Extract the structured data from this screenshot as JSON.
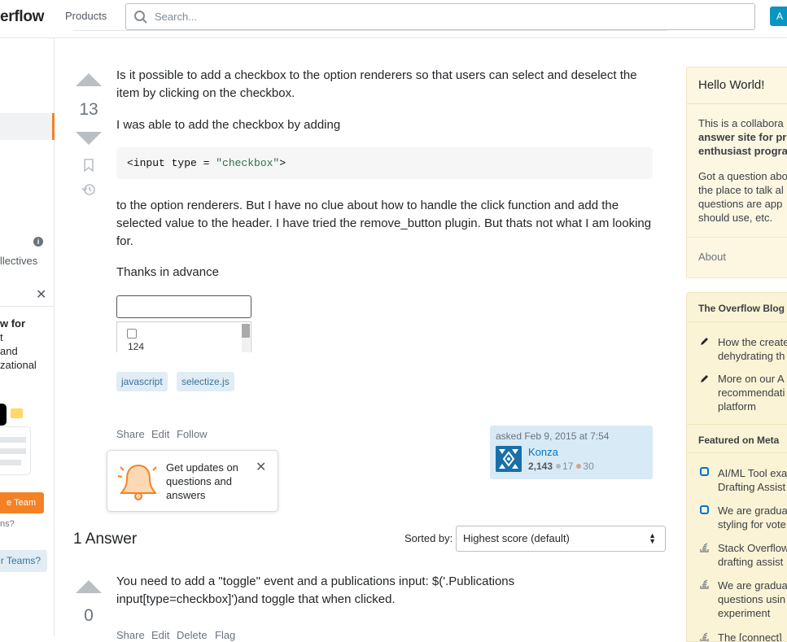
{
  "topbar": {
    "logo": "erflow",
    "products": "Products",
    "search_placeholder": "Search...",
    "avatar_letter": "A"
  },
  "left_sidebar": {
    "collectives": "llectives",
    "promo_lines": [
      "w for",
      "t",
      "and",
      "zational"
    ],
    "team_button": "e Team",
    "teams_question": "ns?",
    "teams_button": "r Teams?"
  },
  "question": {
    "score": "13",
    "paragraphs": [
      "Is it possible to add a checkbox to the option renderers so that users can select and deselect the item by clicking on the checkbox.",
      "I was able to add the checkbox by adding",
      "to the option renderers. But I have no clue about how to handle the click function and add the selected value to the header. I have tried the remove_button plugin. But thats not what I am looking for.",
      "Thanks in advance"
    ],
    "code_prefix": "<input type = ",
    "code_string": "\"checkbox\"",
    "code_suffix": ">",
    "image_list_value": "124",
    "tags": [
      "javascript",
      "selectize.js"
    ],
    "menu": [
      "Share",
      "Edit",
      "Follow"
    ],
    "asked": "asked Feb 9, 2015 at 7:54",
    "user_name": "Konza",
    "reputation": "2,143",
    "silver_badges": "17",
    "bronze_badges": "30",
    "badge_colors": {
      "silver": "#b4b8bc",
      "bronze": "#d1a684"
    }
  },
  "popover": {
    "text": "Get updates on questions and answers"
  },
  "answers": {
    "title": "1 Answer",
    "sorted_by_label": "Sorted by:",
    "sort_value": "Highest score (default)",
    "first_answer": {
      "score": "0",
      "text": "You need to add a \"toggle\" event and a publications input: $('.Publications input[type=checkbox]')and toggle that when clicked.",
      "menu": [
        "Share",
        "Edit",
        "Delete",
        "Flag"
      ]
    }
  },
  "right_sidebar": {
    "hello_title": "Hello World!",
    "hello_p1": [
      "This is a collabora",
      "answer site for pro",
      "enthusiast progra"
    ],
    "hello_p2": [
      "Got a question abo",
      "the place to talk al",
      "questions are app",
      "should use, etc."
    ],
    "about": "About",
    "blog_header": "The Overflow Blog",
    "blog_items": [
      [
        "How the create",
        "dehydrating th"
      ],
      [
        "More on our A",
        "recommendati",
        "platform"
      ]
    ],
    "meta_header": "Featured on Meta",
    "meta_items": [
      [
        "AI/ML Tool exa",
        "Drafting Assist"
      ],
      [
        "We are gradua",
        "styling for vote"
      ],
      [
        "Stack Overflow",
        "drafting assist"
      ],
      [
        "We are gradua",
        "questions usin",
        "experiment"
      ],
      [
        "The [connect]"
      ]
    ]
  },
  "colors": {
    "accent_orange": "#f48225",
    "link_blue": "#0074cc",
    "tag_bg": "#e1ecf4",
    "sidebar_yellow": "#fdf7e2"
  }
}
